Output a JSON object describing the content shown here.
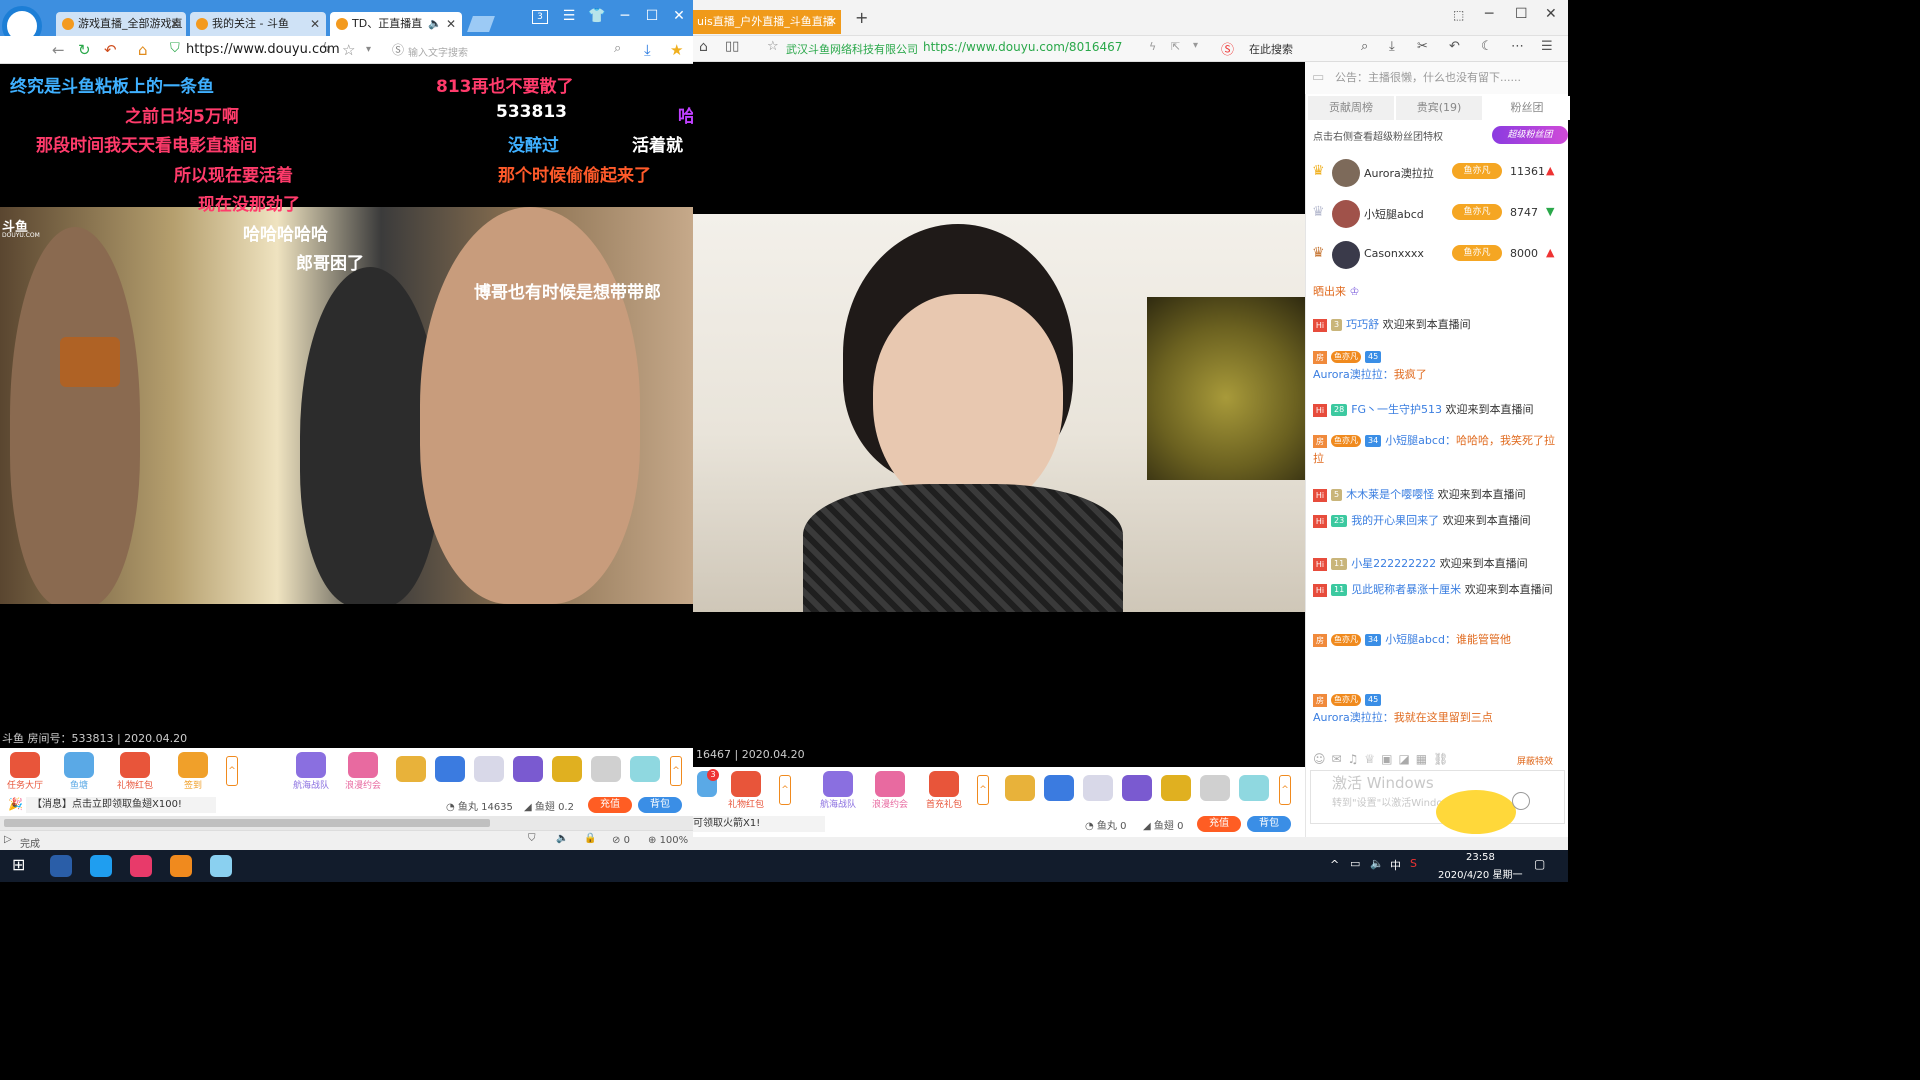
{
  "left_browser": {
    "tabs": [
      {
        "label": "游戏直播_全部游戏直"
      },
      {
        "label": "我的关注 - 斗鱼"
      },
      {
        "label": "TD、正直播直"
      }
    ],
    "url": "https://www.douyu.com",
    "search_placeholder": "输入文字搜索",
    "tab_count": "3",
    "danmu": [
      {
        "text": "终究是斗鱼粘板上的一条鱼",
        "color": "#3fb0ff"
      },
      {
        "text": "813再也不要散了",
        "color": "#ff3b6b"
      },
      {
        "text": "之前日均5万啊",
        "color": "#ff3b6b"
      },
      {
        "text": "533813",
        "color": "#ffffff"
      },
      {
        "text": "哈",
        "color": "#c040ff"
      },
      {
        "text": "那段时间我天天看电影直播间",
        "color": "#ff3b6b"
      },
      {
        "text": "没醉过",
        "color": "#3fb0ff"
      },
      {
        "text": "活着就",
        "color": "#ffffff"
      },
      {
        "text": "所以现在要活着",
        "color": "#ff3b6b"
      },
      {
        "text": "那个时候偷偷起来了",
        "color": "#ff5a2a"
      },
      {
        "text": "现在没那劲了",
        "color": "#ff3b6b"
      },
      {
        "text": "哈哈哈哈哈",
        "color": "#ffffff"
      },
      {
        "text": "郎哥困了",
        "color": "#ffffff"
      },
      {
        "text": "博哥也有时候是想带带郎",
        "color": "#ffffff"
      }
    ],
    "watermark": "斗鱼",
    "watermark_sub": "DOUYU.COM",
    "room_info": "斗鱼 房间号：533813 | 2020.04.20",
    "gifts": [
      {
        "label": "任务大厅",
        "color": "#e8553a"
      },
      {
        "label": "鱼塘",
        "color": "#5aa9e6"
      },
      {
        "label": "礼物红包",
        "color": "#e8553a"
      },
      {
        "label": "签到",
        "color": "#f0a02a"
      },
      {
        "label": "航海战队",
        "color": "#8a6fe0"
      },
      {
        "label": "浪漫约会",
        "color": "#e86aa0"
      }
    ],
    "gift_items_colors": [
      "#e8b23a",
      "#3b7be0",
      "#d8d8e8",
      "#7a5ad0",
      "#e0b020",
      "#d0d0d0",
      "#8fd8e0"
    ],
    "news": "【消息】点击立即领取鱼翅X100!",
    "yuwan_label": "鱼丸",
    "yuwan": "14635",
    "yuchi_label": "鱼翅",
    "yuchi": "0.2",
    "recharge": "充值",
    "backpack": "背包",
    "status_done": "完成",
    "status_count": "0",
    "zoom": "100%"
  },
  "right_browser": {
    "tab_label": "uis直播_户外直播_斗鱼直播",
    "company": "武汉斗鱼网络科技有限公司",
    "url": "https://www.douyu.com/8016467",
    "search_label": "在此搜索",
    "side_numbers": [
      "467",
      "is",
      "is"
    ],
    "room_info": "16467 | 2020.04.20",
    "news": "可领取火箭X1!",
    "gifts": [
      {
        "label": "礼物红包",
        "color": "#e8553a"
      },
      {
        "label": "航海战队",
        "color": "#8a6fe0"
      },
      {
        "label": "浪漫约会",
        "color": "#e86aa0"
      },
      {
        "label": "首充礼包",
        "color": "#e8553a"
      }
    ],
    "gift_badge": "3",
    "gift_items_colors": [
      "#e8b23a",
      "#3b7be0",
      "#d8d8e8",
      "#7a5ad0",
      "#e0b020",
      "#d0d0d0",
      "#8fd8e0"
    ],
    "yuwan_label": "鱼丸",
    "yuwan": "0",
    "yuchi_label": "鱼翅",
    "yuchi": "0",
    "recharge": "充值",
    "backpack": "背包"
  },
  "chat": {
    "notice": "公告：主播很懒，什么也没有留下......",
    "tabs": [
      "贡献周榜",
      "贵宾(19)",
      "粉丝团"
    ],
    "fan_hint": "点击右侧查看超级粉丝团特权",
    "fan_badge": "超级粉丝团",
    "ranking": [
      {
        "name": "Aurora澳拉拉",
        "badge": "鱼亦凡",
        "score": "11361",
        "trend": "up"
      },
      {
        "name": "小短腿abcd",
        "badge": "鱼亦凡",
        "score": "8747",
        "trend": "down"
      },
      {
        "name": "Casonxxxx",
        "badge": "鱼亦凡",
        "score": "8000",
        "trend": "up"
      }
    ],
    "messages": [
      {
        "type": "partial",
        "text": "晒出来"
      },
      {
        "type": "hi",
        "level": "3",
        "user": "巧巧舒",
        "text": "欢迎来到本直播间"
      },
      {
        "type": "fang",
        "badge": "鱼亦凡",
        "level": "45",
        "user": "Aurora澳拉拉：",
        "text": "我疯了"
      },
      {
        "type": "hi",
        "level": "28",
        "user": "FG丶一生守护513",
        "text": "欢迎来到本直播间"
      },
      {
        "type": "fang",
        "badge": "鱼亦凡",
        "level": "34",
        "user": "小短腿abcd：",
        "text": "哈哈哈，我笑死了拉拉"
      },
      {
        "type": "hi",
        "level": "5",
        "user": "木木莱是个嘤嘤怪",
        "text": "欢迎来到本直播间"
      },
      {
        "type": "hi",
        "level": "23",
        "user": "我的开心果回来了",
        "text": "欢迎来到本直播间"
      },
      {
        "type": "hi",
        "level": "11",
        "user": "小星222222222",
        "text": "欢迎来到本直播间"
      },
      {
        "type": "hi",
        "level": "11",
        "user": "见此昵称者暴涨十厘米",
        "text": "欢迎来到本直播间"
      },
      {
        "type": "fang",
        "badge": "鱼亦凡",
        "level": "34",
        "user": "小短腿abcd：",
        "text": "谁能管管他"
      },
      {
        "type": "fang",
        "badge": "鱼亦凡",
        "level": "45",
        "user": "Aurora澳拉拉：",
        "text": "我就在这里留到三点"
      }
    ],
    "input_placeholder": "转到\"设置\"以激活Windows。",
    "win_activate": "激活 Windows",
    "block_gift": "屏蔽特效"
  },
  "taskbar": {
    "time": "23:58",
    "date": "2020/4/20 星期一",
    "ime": "中"
  }
}
